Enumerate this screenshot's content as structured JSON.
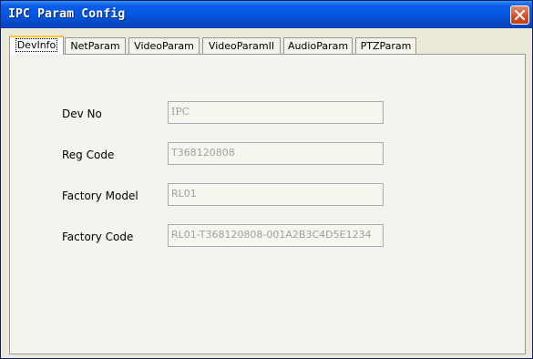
{
  "window": {
    "title": "IPC Param Config",
    "close_label": "close"
  },
  "tabs": [
    {
      "label": "DevInfo",
      "active": true
    },
    {
      "label": "NetParam",
      "active": false
    },
    {
      "label": "VideoParam",
      "active": false
    },
    {
      "label": "VideoParamII",
      "active": false
    },
    {
      "label": "AudioParam",
      "active": false
    },
    {
      "label": "PTZParam",
      "active": false
    }
  ],
  "dev_info": {
    "dev_no": {
      "label": "Dev No",
      "value": "IPC"
    },
    "reg_code": {
      "label": "Reg Code",
      "value": "T368120808"
    },
    "factory_model": {
      "label": "Factory Model",
      "value": "RL01"
    },
    "factory_code": {
      "label": "Factory Code",
      "value": "RL01-T368120808-001A2B3C4D5E1234"
    }
  },
  "colors": {
    "titlebar": "#0654dd",
    "active_tab_accent": "#ffc83c",
    "close_button": "#d2502a",
    "disabled_text": "#a0a0a0"
  },
  "icons": {
    "close": "close-icon"
  }
}
